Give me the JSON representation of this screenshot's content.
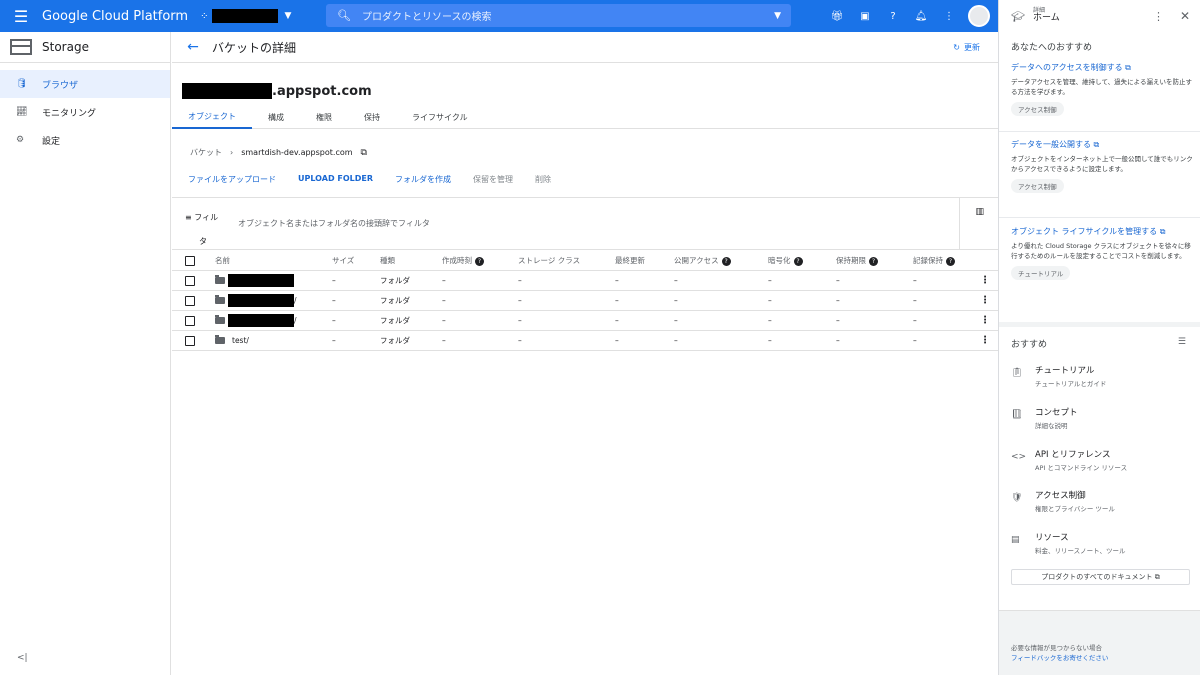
{
  "topbar": {
    "product": "Google Cloud Platform",
    "search_placeholder": "プロダクトとリソースの検索"
  },
  "sidenav": {
    "title": "Storage",
    "items": [
      {
        "label": "ブラウザ",
        "icon": "bucket-icon",
        "active": true
      },
      {
        "label": "モニタリング",
        "icon": "chart-icon",
        "active": false
      },
      {
        "label": "設定",
        "icon": "gear-icon",
        "active": false
      }
    ]
  },
  "main": {
    "title": "バケットの詳細",
    "refresh_label": "更新",
    "bucket_suffix": ".appspot.com",
    "tabs": [
      "オブジェクト",
      "構成",
      "権限",
      "保持",
      "ライフサイクル"
    ],
    "breadcrumb_root": "バケット",
    "breadcrumb_bucket": "smartdish-dev.appspot.com",
    "actions": {
      "upload_files": "ファイルをアップロード",
      "upload_folder": "UPLOAD FOLDER",
      "create_folder": "フォルダを作成",
      "manage_holds": "保留を管理",
      "delete": "削除"
    },
    "filter_label_1": "フィル",
    "filter_label_2": "タ",
    "filter_placeholder": "オブジェクト名またはフォルダ名の接頭辞でフィルタ",
    "columns": [
      "名前",
      "サイズ",
      "種類",
      "作成時刻",
      "ストレージ クラス",
      "最終更新",
      "公開アクセス",
      "暗号化",
      "保持期限",
      "記録保持"
    ],
    "rows": [
      {
        "name": "",
        "suffix": "",
        "size": "–",
        "type": "フォルダ",
        "created": "–",
        "storage": "–",
        "updated": "–",
        "public": "–",
        "encrypt": "–",
        "retention": "–",
        "hold": "–"
      },
      {
        "name": "",
        "suffix": "/",
        "size": "–",
        "type": "フォルダ",
        "created": "–",
        "storage": "–",
        "updated": "–",
        "public": "–",
        "encrypt": "–",
        "retention": "–",
        "hold": "–"
      },
      {
        "name": "",
        "suffix": "/",
        "size": "–",
        "type": "フォルダ",
        "created": "–",
        "storage": "–",
        "updated": "–",
        "public": "–",
        "encrypt": "–",
        "retention": "–",
        "hold": "–"
      },
      {
        "name": "test/",
        "suffix": "",
        "size": "–",
        "type": "フォルダ",
        "created": "–",
        "storage": "–",
        "updated": "–",
        "public": "–",
        "encrypt": "–",
        "retention": "–",
        "hold": "–"
      }
    ]
  },
  "panel": {
    "subtitle": "詳細",
    "title": "ホーム",
    "recommend_heading": "あなたへのおすすめ",
    "recs": [
      {
        "link": "データへのアクセスを制御する",
        "desc": "データアクセスを管理、維持して、過失による漏えいを防止する方法を学びます。",
        "chip": "アクセス制御"
      },
      {
        "link": "データを一般公開する",
        "desc": "オブジェクトをインターネット上で一般公開して誰でもリンクからアクセスできるように設定します。",
        "chip": "アクセス制御"
      },
      {
        "link": "オブジェクト ライフサイクルを管理する",
        "desc": "より優れた Cloud Storage クラスにオブジェクトを徐々に移行するためのルールを設定することでコストを削減します。",
        "chip": "チュートリアル"
      }
    ],
    "osusume": "おすすめ",
    "resources": [
      {
        "title": "チュートリアル",
        "sub": "チュートリアルとガイド",
        "icon": "clipboard-icon"
      },
      {
        "title": "コンセプト",
        "sub": "詳細な説明",
        "icon": "book-icon"
      },
      {
        "title": "API とリファレンス",
        "sub": "API とコマンドライン リソース",
        "icon": "code-icon"
      },
      {
        "title": "アクセス制御",
        "sub": "権限とプライバシー ツール",
        "icon": "shield-icon"
      },
      {
        "title": "リソース",
        "sub": "料金、リリースノート、ツール",
        "icon": "library-icon"
      }
    ],
    "all_docs": "プロダクトのすべてのドキュメント",
    "footer_text": "必要な情報が見つからない場合",
    "footer_link": "フィードバックをお寄せください"
  }
}
